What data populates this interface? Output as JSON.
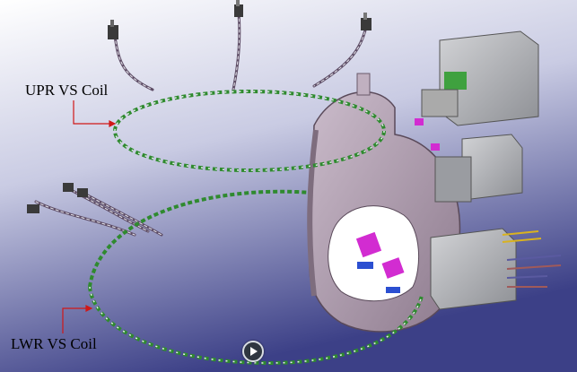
{
  "labels": {
    "upper": "UPR VS Coil",
    "lower": "LWR VS Coil"
  },
  "icons": {
    "play": "play-icon"
  },
  "colors": {
    "background_top": "#f7f7fb",
    "background_bottom": "#3b3f86",
    "coil_green": "#2f8a2f",
    "coil_white": "#e8ecef",
    "coil_purple": "#7a4f86",
    "vessel": "#b9a8b9",
    "magenta_part": "#d22cd1",
    "box_grey": "#b5b6ba",
    "callout_arrow": "#d01818"
  }
}
